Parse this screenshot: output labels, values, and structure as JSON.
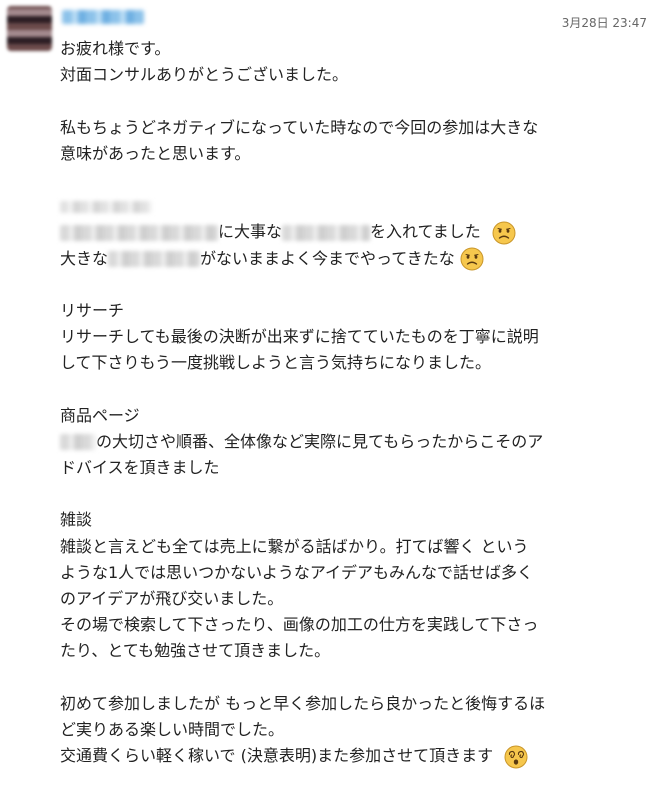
{
  "message": {
    "timestamp": "3月28日 23:47",
    "line_greeting": "お疲れ様です。",
    "line_thanks": "対面コンサルありがとうございました。",
    "para1_line1": "私もちょうどネガティブになっていた時なので今回の参加は大きな",
    "para1_line2": "意味があったと思います。",
    "para2_line1_part1": "に大事な",
    "para2_line1_part2": "を入れてました",
    "para2_line2_part1": "大きな",
    "para2_line2_part2": "がないままよく今までやってきたな",
    "research_title": "リサーチ",
    "research_line1": "リサーチしても最後の決断が出来ずに捨てていたものを丁寧に説明",
    "research_line2": "して下さりもう一度挑戦しようと言う気持ちになりました。",
    "product_title": "商品ページ",
    "product_line1": "の大切さや順番、全体像など実際に見てもらったからこそのア",
    "product_line2": "ドバイスを頂きました",
    "chat_title": "雑談",
    "chat_line1": "雑談と言えども全ては売上に繋がる話ばかり。打てば響く  という",
    "chat_line2": "ような1人では思いつかないようなアイデアもみんなで話せば多く",
    "chat_line3": "のアイデアが飛び交いました。",
    "chat_line4": "その場で検索して下さったり、画像の加工の仕方を実践して下さっ",
    "chat_line5": "たり、とても勉強させて頂きました。",
    "closing_line1": "初めて参加しましたが もっと早く参加したら良かったと後悔するほ",
    "closing_line2": "ど実りある楽しい時間でした。",
    "closing_line3": "交通費くらい軽く稼いで (決意表明)また参加させて頂きます"
  },
  "icons": {
    "sad_emoji": "sad-face-emoji",
    "dizzy_emoji": "dizzy-face-emoji"
  },
  "colors": {
    "text": "#222222",
    "timestamp": "#666666",
    "emoji_face": "#f6c74d"
  }
}
